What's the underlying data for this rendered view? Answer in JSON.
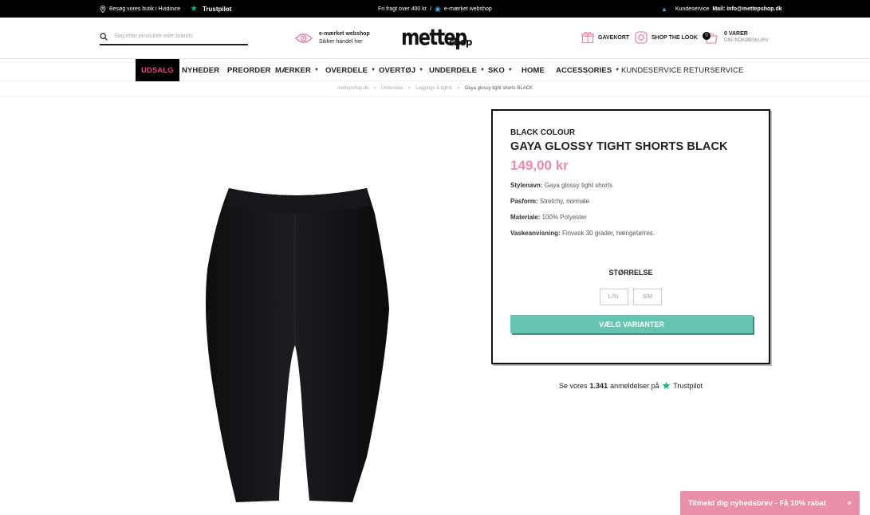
{
  "topbar": {
    "store": "Besøg vores butik i Hvidovre",
    "trustpilot": "Trustpilot",
    "shipping": "Fri fragt over 400 kr",
    "separator": "/",
    "emarket": "e-mærket webshop",
    "service_label": "Kundeservice",
    "service_mail": "Mail: info@mettepshop.dk"
  },
  "header": {
    "search_placeholder": "Søg efter produkter eller brands",
    "emarket_title": "e-mærket webshop",
    "emarket_sub": "Sikker handel her",
    "logo_main": "mettep",
    "logo_sub": "shop",
    "giftcard": "GAVEKORT",
    "shop_the_look": "SHOP THE LOOK",
    "cart_count": "0",
    "cart_items": "0 VARER",
    "cart_label": "DIN INDKØBSKURV"
  },
  "nav": [
    {
      "label": "UDSALG"
    },
    {
      "label": "NYHEDER"
    },
    {
      "label": "PREORDER"
    },
    {
      "label": "MÆRKER"
    },
    {
      "label": "OVERDELE"
    },
    {
      "label": "OVERTØJ"
    },
    {
      "label": "UNDERDELE"
    },
    {
      "label": "SKO"
    },
    {
      "label": "HOME"
    },
    {
      "label": "ACCESSORIES"
    },
    {
      "label": "KUNDESERVICE"
    },
    {
      "label": "RETURSERVICE"
    }
  ],
  "breadcrumb": [
    "mettepshop.dk",
    ">",
    "Underdele",
    ">",
    "Leggings & tights",
    ">",
    "Gaya glossy tight shorts BLACK"
  ],
  "product": {
    "brand": "BLACK COLOUR",
    "name": "GAYA GLOSSY TIGHT SHORTS BLACK",
    "price": "149,00 kr",
    "specs": [
      {
        "label": "Stylenavn:",
        "value": "Gaya glossy tight shorts"
      },
      {
        "label": "Pasform:",
        "value": "Stretchy, normale"
      },
      {
        "label": "Materiale:",
        "value": "100% Polyester"
      },
      {
        "label": "Vaskeanvisning:",
        "value": "Finvask 30 grader, hængetørres."
      }
    ],
    "size_title": "STØRRELSE",
    "sizes": [
      "L/XL",
      "S/M"
    ],
    "cta": "VÆLG VARIANTER"
  },
  "reviews": {
    "prefix": "Se vores",
    "count": "1.341",
    "suffix": "anmeldelser på",
    "brand": "Trustpilot"
  },
  "newsletter": {
    "text": "Tilmeld dig nyhedsbrev - Få 10% rabat",
    "plus": "+"
  },
  "colors": {
    "accent_pink": "#e98bb0",
    "cta_green": "#66c5b0",
    "sale_pink": "#e04a7a",
    "trustpilot_green": "#00b67a"
  }
}
